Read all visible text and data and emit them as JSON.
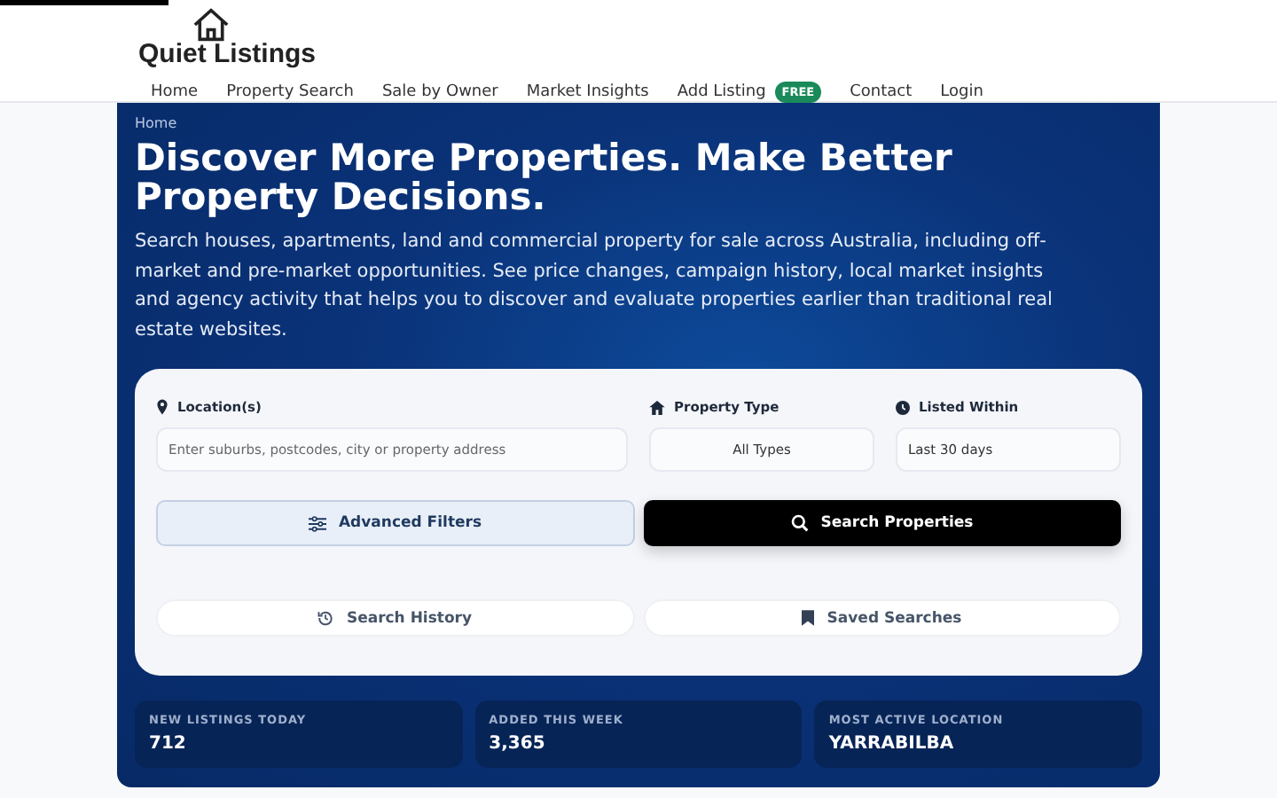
{
  "logo": {
    "text": "Quiet Listings"
  },
  "nav": [
    {
      "label": "Home"
    },
    {
      "label": "Property Search"
    },
    {
      "label": "Sale by Owner"
    },
    {
      "label": "Market Insights"
    },
    {
      "label": "Add Listing",
      "badge": "FREE"
    },
    {
      "label": "Contact"
    },
    {
      "label": "Login"
    }
  ],
  "breadcrumb": "Home",
  "hero": {
    "title": "Discover More Properties. Make Better Property Decisions.",
    "text": "Search houses, apartments, land and commercial property for sale across Australia, including off-market and pre-market opportunities. See price changes, campaign history, local market insights and agency activity that helps you to discover and evaluate properties earlier than traditional real estate websites."
  },
  "search": {
    "location": {
      "label": "Location(s)",
      "placeholder": "Enter suburbs, postcodes, city or property address"
    },
    "property_type": {
      "label": "Property Type",
      "value": "All Types"
    },
    "listed_within": {
      "label": "Listed Within",
      "value": "Last 30 days"
    },
    "advanced_button": "Advanced Filters",
    "search_button": "Search Properties",
    "history_button": "Search History",
    "saved_button": "Saved Searches"
  },
  "stats": [
    {
      "label": "NEW LISTINGS TODAY",
      "value": "712"
    },
    {
      "label": "ADDED THIS WEEK",
      "value": "3,365"
    },
    {
      "label": "MOST ACTIVE LOCATION",
      "value": "YARRABILBA"
    }
  ]
}
